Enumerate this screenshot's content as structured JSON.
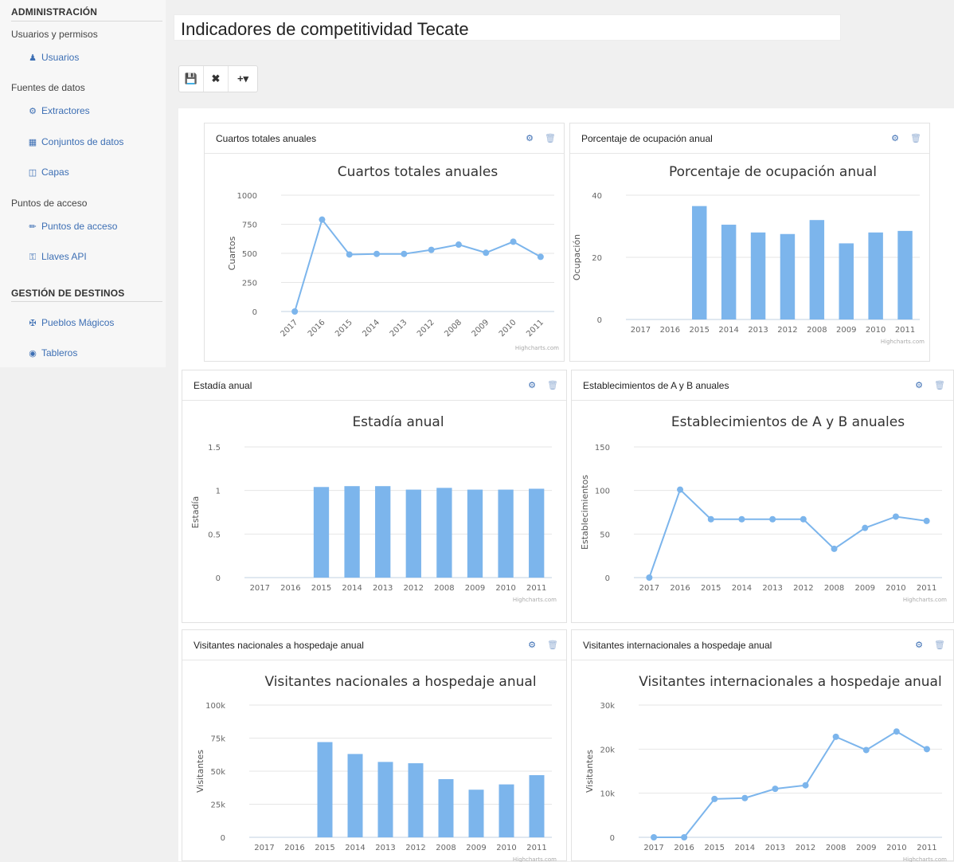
{
  "sidebar": {
    "admin_header": "ADMINISTRACIÓN",
    "groups": [
      {
        "label": "Usuarios y permisos",
        "items": [
          {
            "label": "Usuarios",
            "icon": "user-icon"
          }
        ]
      },
      {
        "label": "Fuentes de datos",
        "items": [
          {
            "label": "Extractores",
            "icon": "gears-icon"
          },
          {
            "label": "Conjuntos de datos",
            "icon": "table-icon"
          },
          {
            "label": "Capas",
            "icon": "map-icon"
          }
        ]
      },
      {
        "label": "Puntos de acceso",
        "items": [
          {
            "label": "Puntos de acceso",
            "icon": "plug-icon"
          },
          {
            "label": "Llaves API",
            "icon": "key-icon"
          }
        ]
      }
    ],
    "dest_header": "GESTIÓN DE DESTINOS",
    "dest_items": [
      {
        "label": "Pueblos Mágicos",
        "icon": "signpost-icon"
      },
      {
        "label": "Tableros",
        "icon": "dashboard-icon"
      }
    ]
  },
  "dashboard": {
    "title": "Indicadores de competitividad Tecate",
    "toolbar": {
      "save_icon": "save-icon",
      "close_icon": "close-icon",
      "add_icon": "plus-dropdown-icon"
    }
  },
  "colors": {
    "bar": "#7cb5ec",
    "line": "#7cb5ec",
    "link": "#3d6fb4"
  },
  "credit": "Highcharts.com",
  "chart_data": [
    {
      "id": "cuartos",
      "type": "line",
      "panel_title": "Cuartos totales anuales",
      "title": "Cuartos totales anuales",
      "ylabel": "Cuartos",
      "ylim": [
        0,
        1000
      ],
      "yticks": [
        "0",
        "250",
        "500",
        "750",
        "1000"
      ],
      "rotated_x": true,
      "categories": [
        "2017",
        "2016",
        "2015",
        "2014",
        "2013",
        "2012",
        "2008",
        "2009",
        "2010",
        "2011"
      ],
      "values": [
        0,
        790,
        490,
        495,
        495,
        530,
        575,
        505,
        600,
        470
      ]
    },
    {
      "id": "ocupacion",
      "type": "bar",
      "panel_title": "Porcentaje de ocupación anual",
      "title": "Porcentaje de ocupación anual",
      "ylabel": "Ocupación",
      "ylim": [
        0,
        40
      ],
      "yticks": [
        "0",
        "20",
        "40"
      ],
      "categories": [
        "2017",
        "2016",
        "2015",
        "2014",
        "2013",
        "2012",
        "2008",
        "2009",
        "2010",
        "2011"
      ],
      "values": [
        null,
        null,
        36.5,
        30.5,
        28,
        27.5,
        32,
        24.5,
        28,
        28.5
      ]
    },
    {
      "id": "estadia",
      "type": "bar",
      "panel_title": "Estadía anual",
      "title": "Estadía anual",
      "ylabel": "Estadía",
      "ylim": [
        0,
        1.5
      ],
      "yticks": [
        "0",
        "0.5",
        "1",
        "1.5"
      ],
      "categories": [
        "2017",
        "2016",
        "2015",
        "2014",
        "2013",
        "2012",
        "2008",
        "2009",
        "2010",
        "2011"
      ],
      "values": [
        null,
        null,
        1.04,
        1.05,
        1.05,
        1.01,
        1.03,
        1.01,
        1.01,
        1.02
      ]
    },
    {
      "id": "establecimientos",
      "type": "line",
      "panel_title": "Establecimientos de A y B anuales",
      "title": "Establecimientos de A y B anuales",
      "ylabel": "Establecimientos",
      "ylim": [
        0,
        150
      ],
      "yticks": [
        "0",
        "50",
        "100",
        "150"
      ],
      "categories": [
        "2017",
        "2016",
        "2015",
        "2014",
        "2013",
        "2012",
        "2008",
        "2009",
        "2010",
        "2011"
      ],
      "values": [
        0,
        101,
        67,
        67,
        67,
        67,
        33,
        57,
        70,
        65
      ]
    },
    {
      "id": "nacionales",
      "type": "bar",
      "panel_title": "Visitantes nacionales a hospedaje anual",
      "title": "Visitantes nacionales a hospedaje anual",
      "ylabel": "Visitantes",
      "ylim": [
        0,
        100000
      ],
      "yticks": [
        "0",
        "25k",
        "50k",
        "75k",
        "100k"
      ],
      "categories": [
        "2017",
        "2016",
        "2015",
        "2014",
        "2013",
        "2012",
        "2008",
        "2009",
        "2010",
        "2011"
      ],
      "values": [
        null,
        null,
        72000,
        63000,
        57000,
        56000,
        44000,
        36000,
        40000,
        47000
      ]
    },
    {
      "id": "internacionales",
      "type": "line",
      "panel_title": "Visitantes internacionales a hospedaje anual",
      "title": "Visitantes internacionales a hospedaje anual",
      "ylabel": "Visitantes",
      "ylim": [
        0,
        30000
      ],
      "yticks": [
        "0",
        "10k",
        "20k",
        "30k"
      ],
      "categories": [
        "2017",
        "2016",
        "2015",
        "2014",
        "2013",
        "2012",
        "2008",
        "2009",
        "2010",
        "2011"
      ],
      "values": [
        0,
        0,
        8700,
        8900,
        11000,
        11800,
        22800,
        19800,
        24000,
        20000
      ]
    }
  ]
}
